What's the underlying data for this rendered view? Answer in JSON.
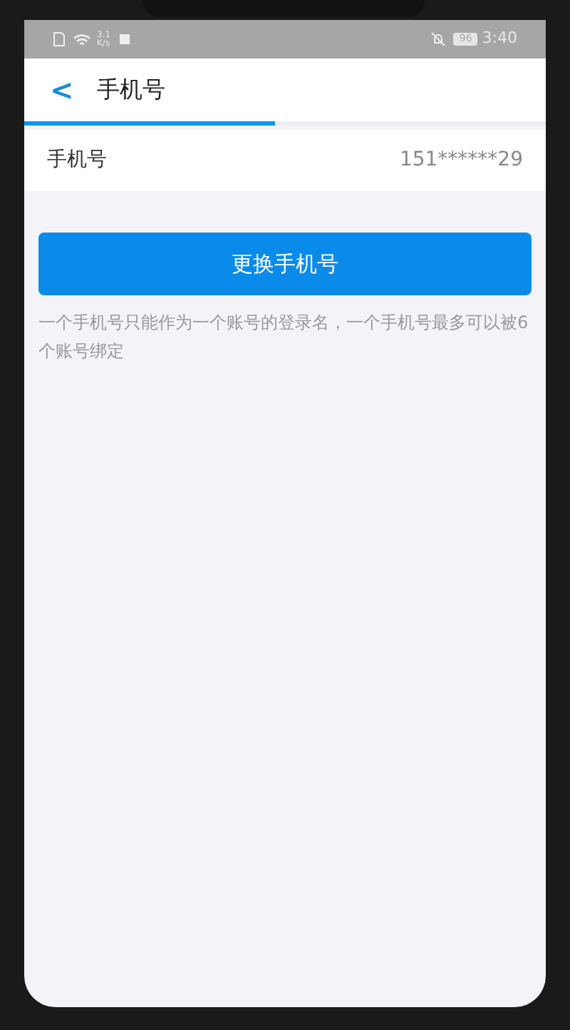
{
  "status_bar": {
    "speed_value": "3.1",
    "speed_unit": "K/s",
    "battery": "96",
    "time": "3:40"
  },
  "header": {
    "back": "<",
    "title": "手机号",
    "loading": {
      "level": 0.48
    }
  },
  "phone_row": {
    "label": "手机号",
    "value": "151******29"
  },
  "change_button": {
    "label": "更换手机号"
  },
  "note": "一个手机号只能作为一个账号的登录名，一个手机号最多可以被6个账号绑定"
}
